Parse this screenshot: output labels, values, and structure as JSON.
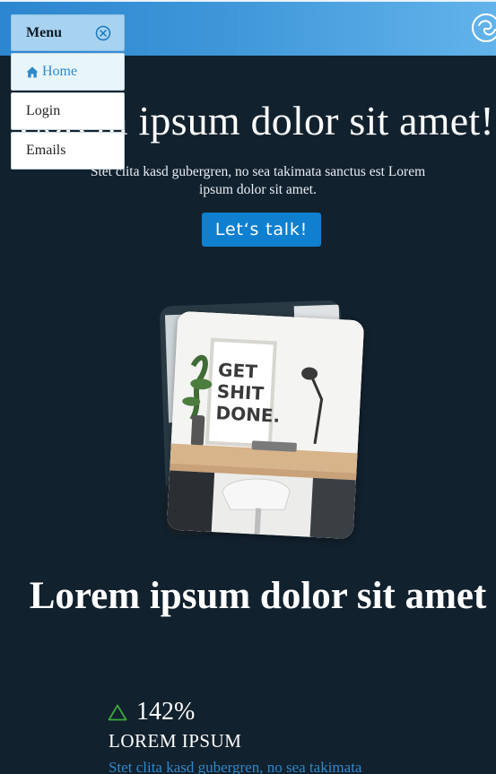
{
  "menu": {
    "title": "Menu",
    "items": [
      {
        "label": "Home",
        "active": true
      },
      {
        "label": "Login",
        "active": false
      },
      {
        "label": "Emails",
        "active": false
      }
    ]
  },
  "hero": {
    "title": "Lorem ipsum dolor sit amet!",
    "subtitle": "Stet clita kasd gubergren, no sea takimata sanctus est Lorem ipsum dolor sit amet.",
    "cta_label": "Let‘s talk!"
  },
  "image": {
    "poster_lines": [
      "GET",
      "SHIT",
      "DONE."
    ]
  },
  "section": {
    "title": "Lorem ipsum dolor sit amet"
  },
  "stat": {
    "value": "142%",
    "label": "LOREM IPSUM",
    "text": "Stet clita kasd gubergren, no sea takimata"
  },
  "colors": {
    "background": "#12212e",
    "accent": "#0f7fcf",
    "link": "#2f88c9",
    "stat_icon": "#3ba93b"
  }
}
